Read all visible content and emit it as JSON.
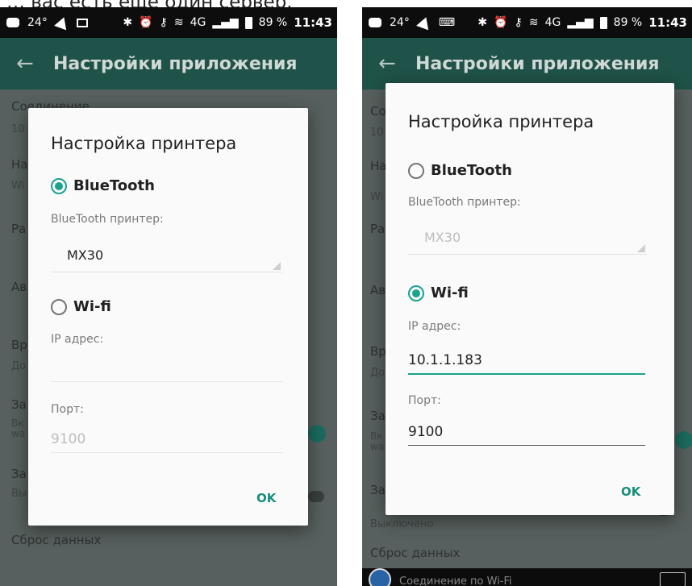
{
  "caption": "… вас есть ещё один сервер.",
  "status_bar": {
    "temperature": "24°",
    "network": "4G",
    "battery": "89 %",
    "time": "11:43"
  },
  "app_bar": {
    "title": "Настройки приложения"
  },
  "background": {
    "left": [
      {
        "title": "Соединение",
        "sub": "10"
      },
      {
        "title": "На",
        "sub": "Wi"
      },
      {
        "title": "Ра",
        "sub": ""
      },
      {
        "title": "Ав",
        "sub": ""
      },
      {
        "title": "Вр",
        "sub": "До"
      },
      {
        "title": "За",
        "sub": "Вк\nwa"
      },
      {
        "title": "За",
        "sub": "Вы"
      },
      {
        "title": "Сброс данных",
        "sub": ""
      }
    ],
    "right": [
      {
        "title": "Со",
        "sub": "10"
      },
      {
        "title": "На",
        "sub": "Wi"
      },
      {
        "title": "Ра",
        "sub": ""
      },
      {
        "title": "Ав",
        "sub": ""
      },
      {
        "title": "Вр",
        "sub": "До"
      },
      {
        "title": "За",
        "sub": "Вк\nwa"
      },
      {
        "title": "За",
        "sub": "Выключено"
      },
      {
        "title": "Сброс данных",
        "sub": ""
      }
    ],
    "bottom_notification": "Соединение по Wi-Fi"
  },
  "dialog": {
    "title": "Настройка принтера",
    "bluetooth_label": "BlueTooth",
    "bluetooth_printer_label": "BlueTooth принтер:",
    "bluetooth_printer_value": "MX30",
    "wifi_label": "Wi-fi",
    "ip_label": "IP адрес:",
    "port_label": "Порт:",
    "ok_label": "OK"
  },
  "left_state": {
    "selected": "bluetooth",
    "ip_value": "",
    "port_value": "9100"
  },
  "right_state": {
    "selected": "wifi",
    "ip_value": "10.1.1.183",
    "port_value": "9100"
  },
  "colors": {
    "accent": "#1aa38d",
    "appbar": "#1f5248"
  }
}
